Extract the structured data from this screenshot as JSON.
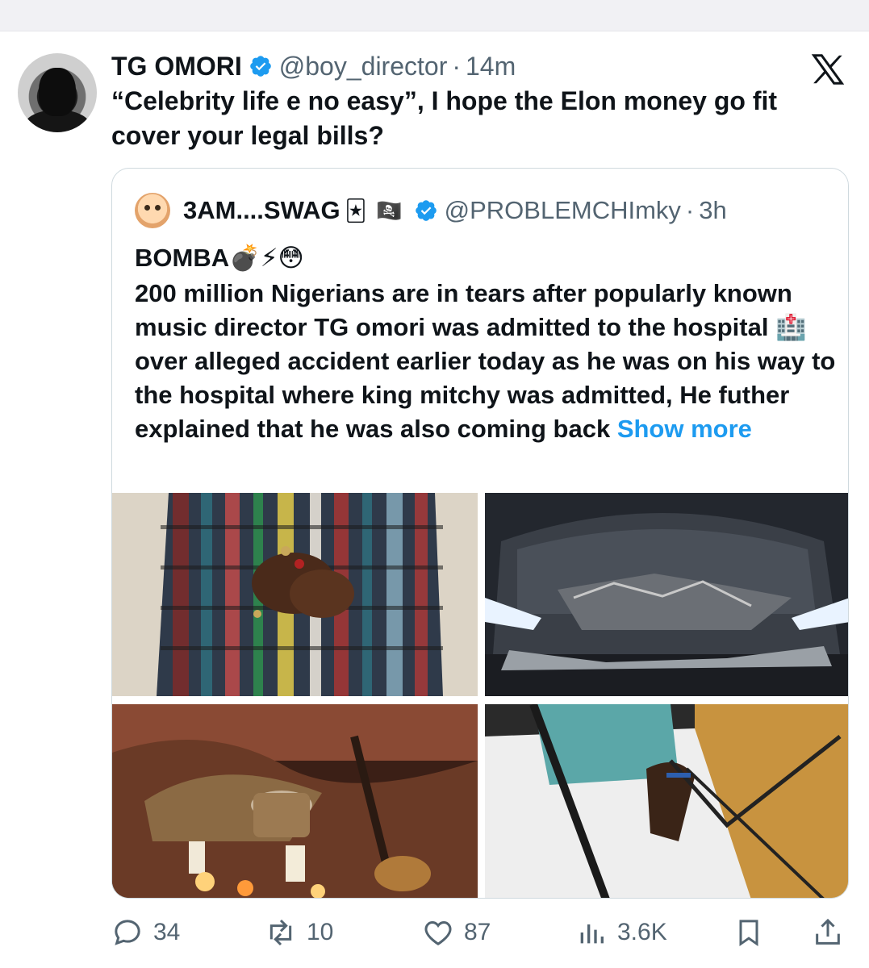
{
  "tweet": {
    "display_name": "TG OMORI",
    "handle": "@boy_director",
    "separator": "·",
    "time": "14m",
    "text": "“Celebrity life e no easy”, I hope the Elon money go fit cover your legal bills?"
  },
  "quote": {
    "display_name": "3AM....SWAG",
    "name_emoji_1": "🃏",
    "name_emoji_2": "🏴‍☠️",
    "handle": "@PROBLEMCHImky",
    "separator": "·",
    "time": "3h",
    "title": "BOMBA💣⚡😳",
    "body": "200 million Nigerians are in tears after popularly known music director TG omori was admitted to the hospital 🏥 over alleged accident earlier today as he was on his way to the hospital where king mitchy was admitted, He futher explained that he was also coming back",
    "show_more": "Show more"
  },
  "actions": {
    "replies": "34",
    "reposts": "10",
    "likes": "87",
    "views": "3.6K"
  },
  "colors": {
    "accent": "#1d9bf0",
    "muted": "#536471",
    "border": "#cfd9de"
  },
  "icons": [
    "verified-badge-icon",
    "x-logo-icon",
    "reply-icon",
    "repost-icon",
    "like-icon",
    "views-icon",
    "bookmark-icon",
    "share-icon"
  ]
}
